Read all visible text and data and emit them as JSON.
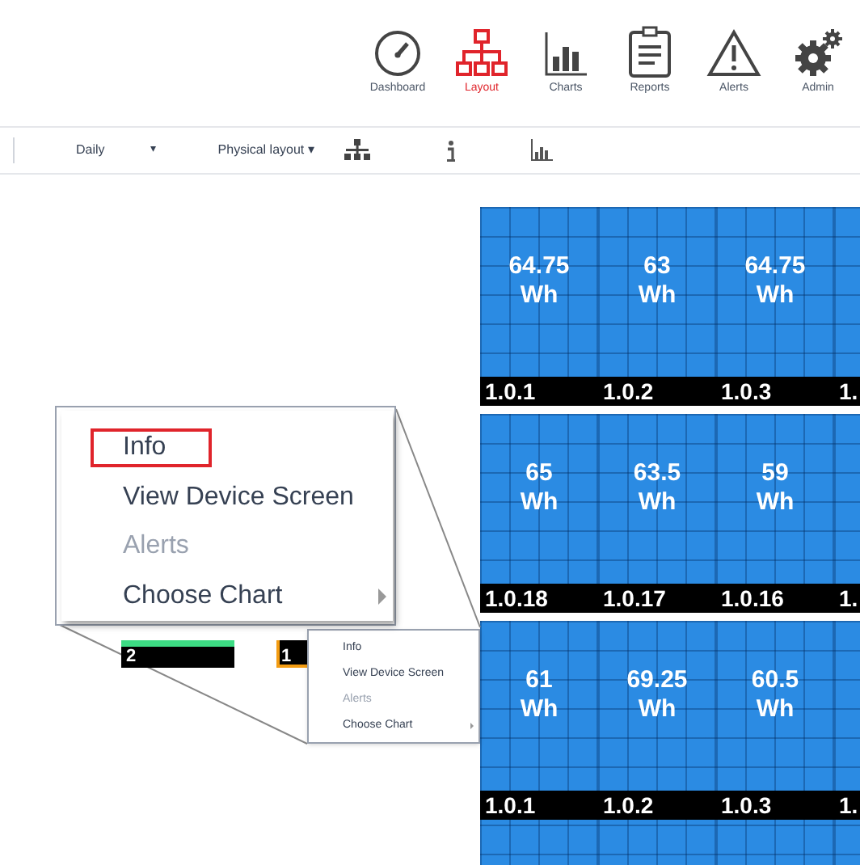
{
  "nav": [
    {
      "label": "Dashboard",
      "selected": false
    },
    {
      "label": "Layout",
      "selected": true
    },
    {
      "label": "Charts",
      "selected": false
    },
    {
      "label": "Reports",
      "selected": false
    },
    {
      "label": "Alerts",
      "selected": false
    },
    {
      "label": "Admin",
      "selected": false
    }
  ],
  "toolbar": {
    "period": "Daily",
    "period_caret": "▾",
    "view": "Physical layout ▾"
  },
  "blocks": [
    {
      "tiles": [
        {
          "value": "64.75",
          "unit": "Wh",
          "label": "1.0.1"
        },
        {
          "value": "63",
          "unit": "Wh",
          "label": "1.0.2"
        },
        {
          "value": "64.75",
          "unit": "Wh",
          "label": "1.0.3"
        },
        {
          "label": "1."
        }
      ]
    },
    {
      "tiles": [
        {
          "value": "65",
          "unit": "Wh",
          "label": "1.0.18"
        },
        {
          "value": "63.5",
          "unit": "Wh",
          "label": "1.0.17"
        },
        {
          "value": "59",
          "unit": "Wh",
          "label": "1.0.16"
        },
        {
          "label": "1."
        }
      ]
    },
    {
      "tiles": [
        {
          "value": "61",
          "unit": "Wh",
          "label": "1.0.1"
        },
        {
          "value": "69.25",
          "unit": "Wh",
          "label": "1.0.2"
        },
        {
          "value": "60.5",
          "unit": "Wh",
          "label": "1.0.3"
        },
        {
          "label": "1."
        }
      ]
    }
  ],
  "small_tiles": [
    {
      "label": "2",
      "kind": "bar",
      "color": "#3ddc84"
    },
    {
      "label": "1",
      "kind": "outline",
      "color": "#f39c12"
    }
  ],
  "zoomed_menu": {
    "items": [
      {
        "label": "Info",
        "disabled": false,
        "highlighted": true,
        "submenu": false
      },
      {
        "label": "View Device Screen",
        "disabled": false,
        "highlighted": false,
        "submenu": false
      },
      {
        "label": "Alerts",
        "disabled": true,
        "highlighted": false,
        "submenu": false
      },
      {
        "label": "Choose Chart",
        "disabled": false,
        "highlighted": false,
        "submenu": true
      }
    ]
  },
  "context_menu": {
    "items": [
      {
        "label": "Info",
        "disabled": false,
        "submenu": false
      },
      {
        "label": "View Device Screen",
        "disabled": false,
        "submenu": false
      },
      {
        "label": "Alerts",
        "disabled": true,
        "submenu": false
      },
      {
        "label": "Choose Chart",
        "disabled": false,
        "submenu": true
      }
    ]
  }
}
